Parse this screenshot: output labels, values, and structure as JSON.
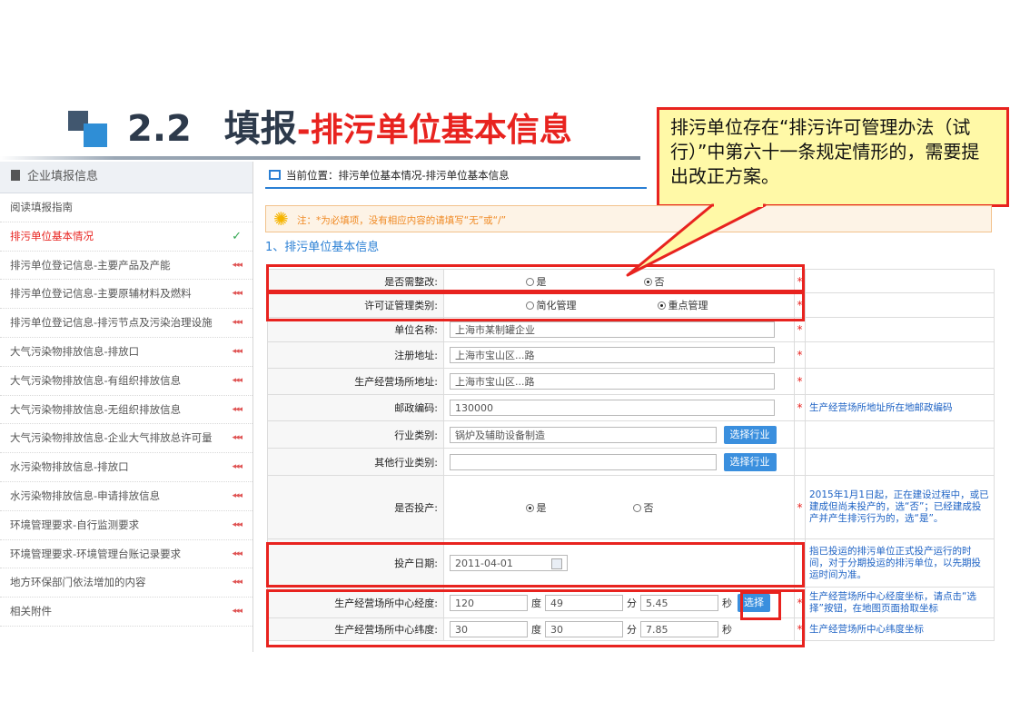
{
  "slide": {
    "number": "2.2",
    "title_main": "填报",
    "title_sub": "-排污单位基本信息"
  },
  "callout": {
    "text": "排污单位存在“排污许可管理办法（试 行）”中第六十一条规定情形的，需要提出改正方案。"
  },
  "sidebar": {
    "header": "企业填报信息",
    "items": [
      {
        "label": "阅读填报指南",
        "icon": ""
      },
      {
        "label": "排污单位基本情况",
        "icon": "check-icon",
        "active": true
      },
      {
        "label": "排污单位登记信息-主要产品及产能",
        "icon": "incomplete-icon"
      },
      {
        "label": "排污单位登记信息-主要原辅材料及燃料",
        "icon": "incomplete-icon"
      },
      {
        "label": "排污单位登记信息-排污节点及污染治理设施",
        "icon": "incomplete-icon"
      },
      {
        "label": "大气污染物排放信息-排放口",
        "icon": "incomplete-icon"
      },
      {
        "label": "大气污染物排放信息-有组织排放信息",
        "icon": "incomplete-icon"
      },
      {
        "label": "大气污染物排放信息-无组织排放信息",
        "icon": "incomplete-icon"
      },
      {
        "label": "大气污染物排放信息-企业大气排放总许可量",
        "icon": "incomplete-icon"
      },
      {
        "label": "水污染物排放信息-排放口",
        "icon": "incomplete-icon"
      },
      {
        "label": "水污染物排放信息-申请排放信息",
        "icon": "incomplete-icon"
      },
      {
        "label": "环境管理要求-自行监测要求",
        "icon": "incomplete-icon"
      },
      {
        "label": "环境管理要求-环境管理台账记录要求",
        "icon": "incomplete-icon"
      },
      {
        "label": "地方环保部门依法增加的内容",
        "icon": "incomplete-icon"
      },
      {
        "label": "相关附件",
        "icon": "incomplete-icon"
      }
    ]
  },
  "breadcrumb": "当前位置：排污单位基本情况-排污单位基本信息",
  "notice": "注：*为必填项，没有相应内容的请填写“无”或“/”",
  "section_title": "1、排污单位基本信息",
  "form": {
    "rectify": {
      "label": "是否需整改:",
      "opt_yes": "是",
      "opt_no": "否",
      "selected": "否"
    },
    "license_type": {
      "label": "许可证管理类别:",
      "opt1": "简化管理",
      "opt2": "重点管理",
      "selected": "重点管理"
    },
    "unit_name": {
      "label": "单位名称:",
      "value": "上海市某制罐企业"
    },
    "reg_address": {
      "label": "注册地址:",
      "value": "上海市宝山区...路"
    },
    "site_address": {
      "label": "生产经营场所地址:",
      "value": "上海市宝山区...路"
    },
    "postcode": {
      "label": "邮政编码:",
      "value": "130000",
      "tip": "生产经营场所地址所在地邮政编码"
    },
    "industry": {
      "label": "行业类别:",
      "value": "锅炉及辅助设备制造",
      "button": "选择行业"
    },
    "other_industry": {
      "label": "其他行业类别:",
      "value": "",
      "button": "选择行业"
    },
    "in_operation": {
      "label": "是否投产:",
      "opt_yes": "是",
      "opt_no": "否",
      "selected": "是",
      "tip": "2015年1月1日起，正在建设过程中，或已建成但尚未投产的，选“否”；已经建成投产并产生排污行为的，选“是”。"
    },
    "operation_date": {
      "label": "投产日期:",
      "value": "2011-04-01",
      "tip": "指已投运的排污单位正式投产运行的时间，对于分期投运的排污单位，以先期投运时间为准。"
    },
    "longitude": {
      "label": "生产经营场所中心经度:",
      "deg": "120",
      "min": "49",
      "sec": "5.45",
      "unit_deg": "度",
      "unit_min": "分",
      "unit_sec": "秒",
      "button": "选择",
      "tip": "生产经营场所中心经度坐标，请点击“选择”按钮，在地图页面拾取坐标"
    },
    "latitude": {
      "label": "生产经营场所中心纬度:",
      "deg": "30",
      "min": "30",
      "sec": "7.85",
      "unit_deg": "度",
      "unit_min": "分",
      "unit_sec": "秒",
      "tip": "生产经营场所中心纬度坐标"
    },
    "required_mark": "*"
  },
  "colors": {
    "accent_red": "#e8231f",
    "link_blue": "#2a7fd4",
    "callout_bg": "#fff9a7"
  }
}
